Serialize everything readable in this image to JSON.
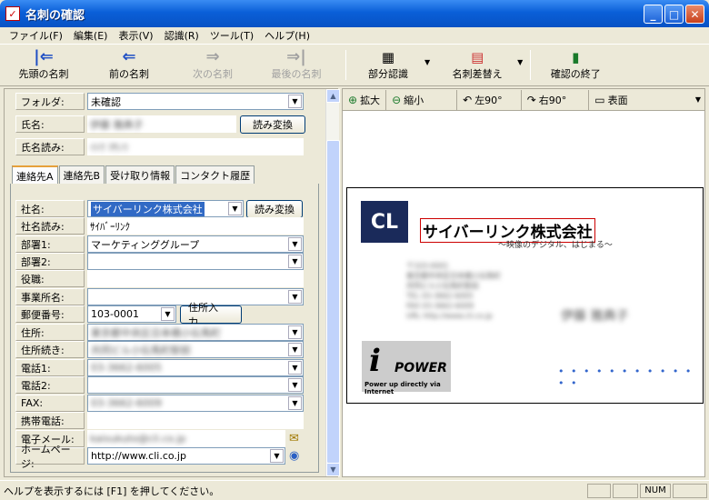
{
  "window": {
    "title": "名刺の確認",
    "app_icon_glyph": "✓"
  },
  "menu": [
    "ファイル(F)",
    "編集(E)",
    "表示(V)",
    "認識(R)",
    "ツール(T)",
    "ヘルプ(H)"
  ],
  "toolbar": {
    "first": "先頭の名刺",
    "prev": "前の名刺",
    "next": "次の名刺",
    "last": "最後の名刺",
    "partial": "部分認識",
    "replace": "名刺差替え",
    "finish": "確認の終了"
  },
  "header_fields": {
    "folder_label": "フォルダ:",
    "folder_value": "未確認",
    "name_label": "氏名:",
    "name_value": "伊藤 雅典子",
    "reading_label": "氏名読み:",
    "reading_value": "ｲﾄｳ ﾏｻﾉﾘ",
    "convert_button": "読み変換"
  },
  "tabs": [
    "連絡先A",
    "連絡先B",
    "受け取り情報",
    "コンタクト履歴"
  ],
  "contact": {
    "company_label": "社名:",
    "company_value": "サイバーリンク株式会社",
    "company_reading_label": "社名読み:",
    "company_reading_value": "ｻｲﾊﾞｰﾘﾝｸ",
    "dept1_label": "部署1:",
    "dept1_value": "マーケティンググループ",
    "dept2_label": "部署2:",
    "title_label": "役職:",
    "office_label": "事業所名:",
    "zip_label": "郵便番号:",
    "zip_value": "103-0001",
    "address_button": "住所入力...",
    "addr_label": "住所:",
    "addr_value": "東京都中央区日本橋小伝馬町",
    "addr2_label": "住所続き:",
    "addr2_value": "共同ビル小伝馬町駅前",
    "tel1_label": "電話1:",
    "tel1_value": "03-3662-6005",
    "tel2_label": "電話2:",
    "fax_label": "FAX:",
    "fax_value": "03-3662-6009",
    "mobile_label": "携帯電話:",
    "email_label": "電子メール:",
    "email_value": "kaisukuto@cli.co.jp",
    "homepage_label": "ホームページ:",
    "homepage_value": "http://www.cli.co.jp"
  },
  "image_toolbar": {
    "zoom_in": "拡大",
    "zoom_out": "縮小",
    "rotate_left": "左90°",
    "rotate_right": "右90°",
    "side": "表面"
  },
  "card": {
    "logo_text": "CL",
    "company": "サイバーリンク株式会社",
    "tagline": "～映像のデジタル、はじまる～",
    "address_lines": [
      "〒103-0001",
      "東京都中央区日本橋小伝馬町",
      "共同ビル小伝馬町駅前",
      "TEL 03-3662-6005",
      "FAX 03-3662-6009",
      "URL http://www.cli.co.jp"
    ],
    "person_name": "伊藤 雅典子",
    "logo2_i": "i",
    "logo2_power": "POWER",
    "logo2_slogan": "Power up directly via Internet",
    "dots": "• • • • • • • • • • • • •"
  },
  "status": {
    "text": "ヘルプを表示するには [F1] を押してください。",
    "num": "NUM"
  }
}
